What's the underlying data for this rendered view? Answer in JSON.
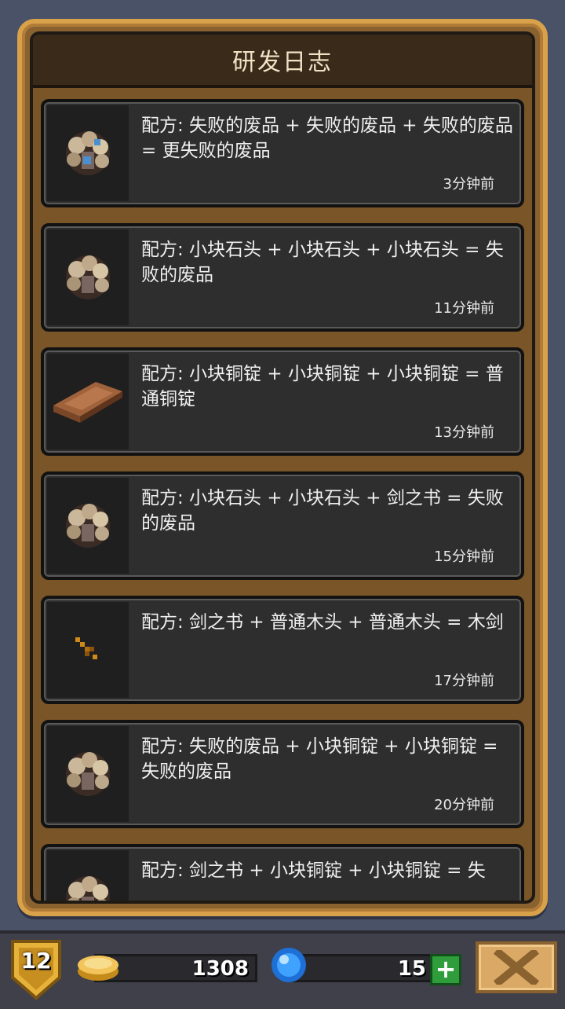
{
  "header": {
    "title": "研发日志"
  },
  "entries": [
    {
      "text": "配方: 失败的废品 + 失败的废品 + 失败的废品 = 更失败的废品",
      "time": "3分钟前",
      "icon": "junk-rock-blue-icon"
    },
    {
      "text": "配方: 小块石头 + 小块石头 + 小块石头 = 失败的废品",
      "time": "11分钟前",
      "icon": "junk-rock-icon"
    },
    {
      "text": "配方: 小块铜锭 + 小块铜锭 + 小块铜锭 = 普通铜锭",
      "time": "13分钟前",
      "icon": "copper-ingot-icon"
    },
    {
      "text": "配方: 小块石头 + 小块石头 + 剑之书 = 失败的废品",
      "time": "15分钟前",
      "icon": "junk-rock-icon"
    },
    {
      "text": "配方: 剑之书 + 普通木头 + 普通木头 = 木剑",
      "time": "17分钟前",
      "icon": "wooden-sword-icon"
    },
    {
      "text": "配方: 失败的废品 + 小块铜锭 + 小块铜锭 = 失败的废品",
      "time": "20分钟前",
      "icon": "junk-rock-icon"
    },
    {
      "text": "配方: 剑之书 + 小块铜锭 + 小块铜锭 = 失",
      "time": "",
      "icon": "junk-rock-icon"
    }
  ],
  "bottom_bar": {
    "level": "12",
    "gold": "1308",
    "gems": "15",
    "add_label": "+",
    "close_icon": "close-x-icon"
  },
  "colors": {
    "background": "#4a5268",
    "panel_border": "#d9a24a",
    "card_bg": "#2e2e2e",
    "gem_button": "#2f9d3c",
    "close_button": "#d9a965"
  }
}
